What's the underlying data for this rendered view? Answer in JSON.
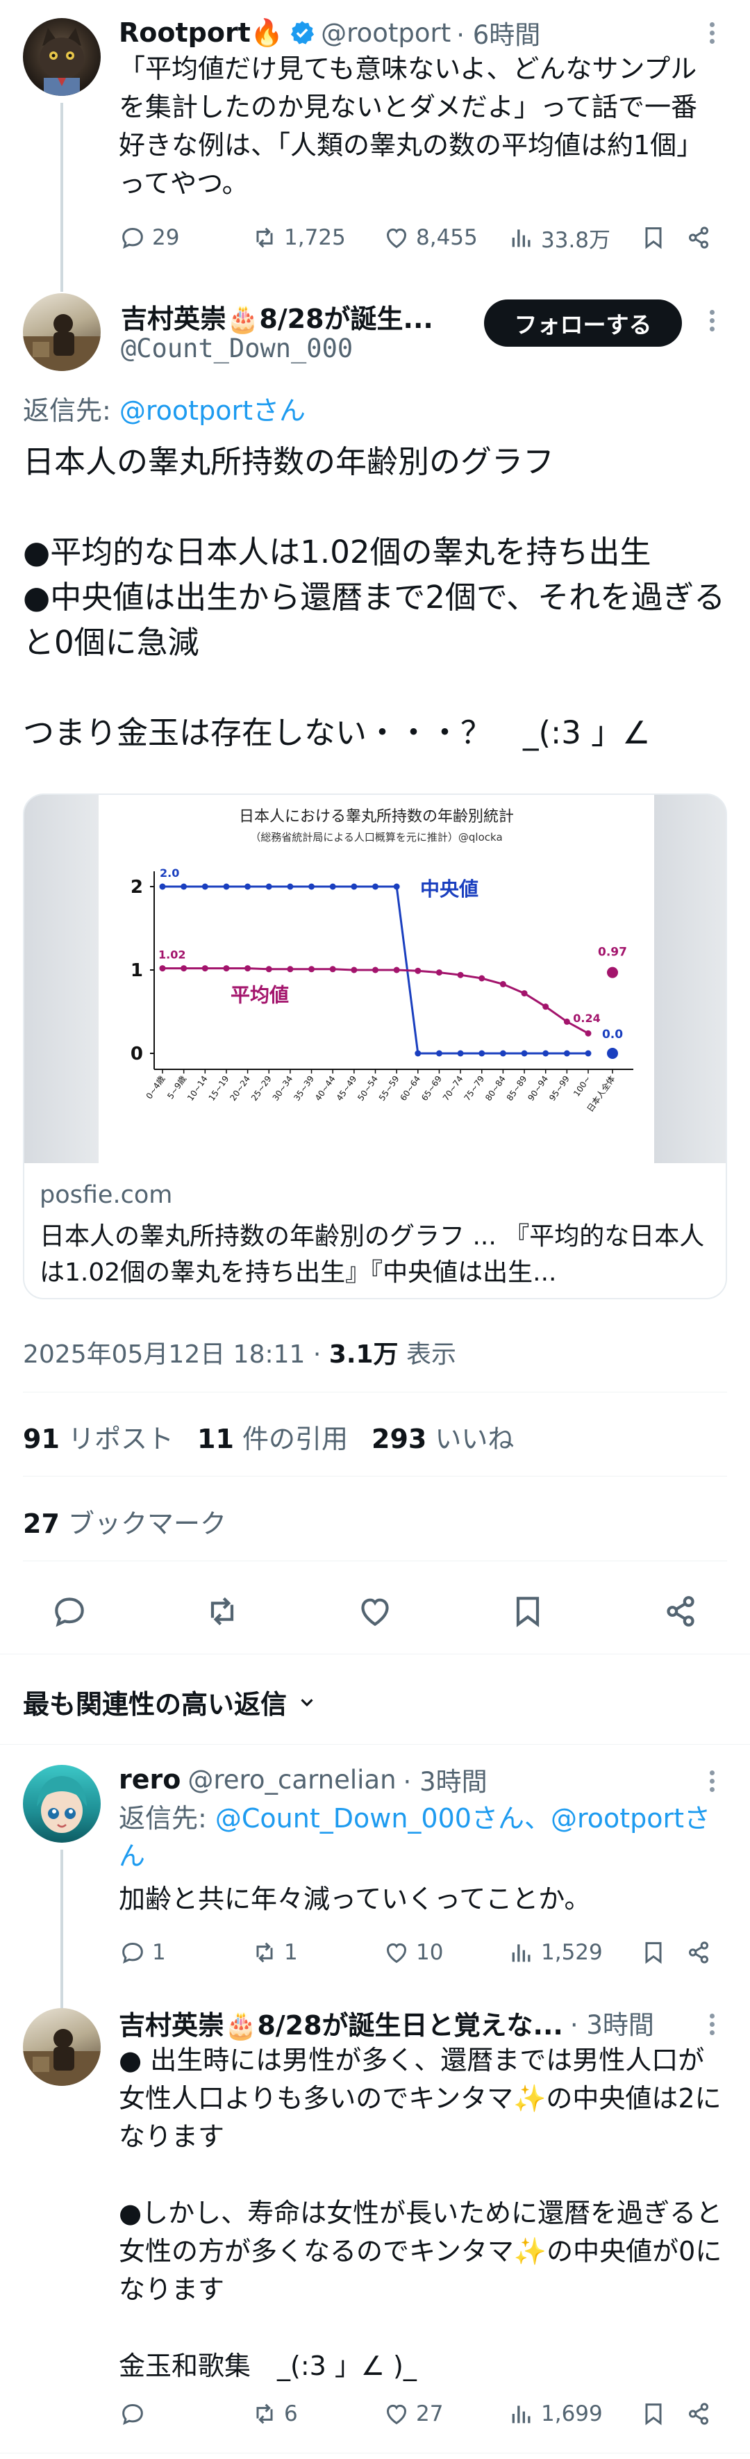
{
  "top_post": {
    "name": "Rootport🔥",
    "handle": "@rootport",
    "time": "· 6時間",
    "text": "「平均値だけ見ても意味ないよ、どんなサンプルを集計したのか見ないとダメだよ」って話で一番好きな例は、「人類の睾丸の数の平均値は約1個」ってやつ。",
    "replies": "29",
    "reposts": "1,725",
    "likes": "8,455",
    "views": "33.8万"
  },
  "main_post": {
    "name": "吉村英崇🎂8/28が誕生...",
    "handle": "@Count_Down_000",
    "follow_label": "フォローする",
    "reply_to_prefix": "返信先: ",
    "reply_to_user": "@rootportさん",
    "text": "日本人の睾丸所持数の年齢別のグラフ\n\n●平均的な日本人は1.02個の睾丸を持ち出生\n●中央値は出生から還暦まで2個で、それを過ぎると0個に急減\n\nつまり金玉は存在しない・・・？　_(:3 」∠",
    "card": {
      "domain": "posfie.com",
      "title": "日本人の睾丸所持数の年齢別のグラフ ... 『平均的な日本人は1.02個の睾丸を持ち出生』『中央値は出生..."
    },
    "timestamp": "2025年05月12日 18:11",
    "views_num": "3.1万",
    "views_label": "表示",
    "reposts_num": "91",
    "reposts_label": "リポスト",
    "quotes_num": "11",
    "quotes_label": "件の引用",
    "likes_num": "293",
    "likes_label": "いいね",
    "bookmarks_num": "27",
    "bookmarks_label": "ブックマーク"
  },
  "sort_label": "最も関連性の高い返信",
  "replies": [
    {
      "name": "rero",
      "handle": "@rero_carnelian",
      "time": "· 3時間",
      "reply_prefix": "返信先: ",
      "reply_users": "@Count_Down_000さん、@rootportさん",
      "text": "加齢と共に年々減っていくってことか。",
      "replies": "1",
      "reposts": "1",
      "likes": "10",
      "views": "1,529"
    },
    {
      "name": "吉村英崇🎂8/28が誕生日と覚えな...",
      "time": "· 3時間",
      "text": "● 出生時には男性が多く、還暦までは男性人口が女性人口よりも多いのでキンタマ✨の中央値は2になります\n\n●しかし、寿命は女性が長いために還暦を過ぎると女性の方が多くなるのでキンタマ✨の中央値が0になります\n\n金玉和歌集　_(:3 」∠ )_",
      "replies": "",
      "reposts": "6",
      "likes": "27",
      "views": "1,699"
    }
  ],
  "chart_data": {
    "type": "line",
    "title": "日本人における睾丸所持数の年齢別統計",
    "subtitle": "（総務省統計局による人口概算を元に推計）@qlocka",
    "categories": [
      "0~4歳",
      "5~9歳",
      "10~14",
      "15~19",
      "20~24",
      "25~29",
      "30~34",
      "35~39",
      "40~44",
      "45~49",
      "50~54",
      "55~59",
      "60~64",
      "65~69",
      "70~74",
      "75~79",
      "80~84",
      "85~89",
      "90~94",
      "95~99",
      "100~",
      "日本人全体"
    ],
    "series": [
      {
        "name": "中央値",
        "color": "#1a3fbf",
        "values": [
          2,
          2,
          2,
          2,
          2,
          2,
          2,
          2,
          2,
          2,
          2,
          2,
          0,
          0,
          0,
          0,
          0,
          0,
          0,
          0,
          0
        ],
        "total": 0.0
      },
      {
        "name": "平均値",
        "color": "#a3146c",
        "values": [
          1.02,
          1.02,
          1.02,
          1.02,
          1.02,
          1.01,
          1.01,
          1.01,
          1.01,
          1.0,
          1.0,
          1.0,
          0.99,
          0.97,
          0.94,
          0.9,
          0.83,
          0.72,
          0.56,
          0.38,
          0.24
        ],
        "total": 0.97
      }
    ],
    "labels": {
      "median_start": "2.0",
      "mean_start": "1.02",
      "mean_end": "0.24",
      "mean_total": "0.97",
      "median_total": "0.0"
    },
    "ylim": [
      0,
      2
    ],
    "yticks": [
      "0",
      "1",
      "2"
    ]
  }
}
